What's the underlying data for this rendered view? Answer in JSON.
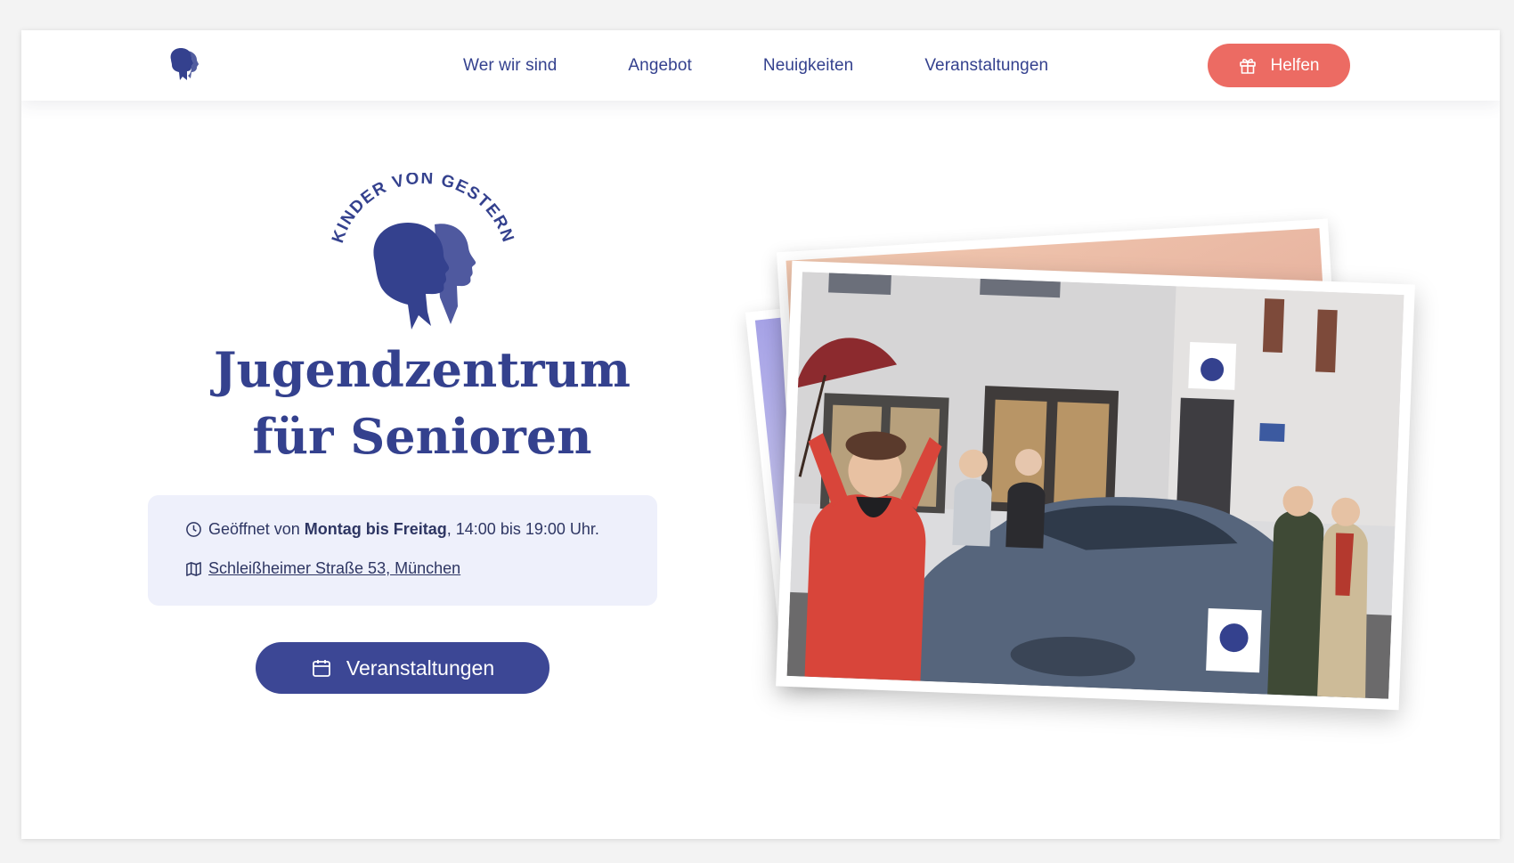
{
  "nav": {
    "links": [
      "Wer wir sind",
      "Angebot",
      "Neuigkeiten",
      "Veranstaltungen"
    ],
    "help_label": "Helfen"
  },
  "hero": {
    "logo_text": "KINDER VON GESTERN",
    "title_line1": "Jugendzentrum",
    "title_line2": "für Senioren",
    "hours_prefix": "Geöffnet von ",
    "hours_days": "Montag bis Freitag",
    "hours_suffix": ", 14:00 bis 19:00 Uhr.",
    "address": "Schleißheimer Straße 53, München",
    "events_button": "Veranstaltungen"
  },
  "colors": {
    "brand_blue": "#34418e",
    "accent_red": "#ec6b63",
    "info_bg": "#eef0fb",
    "button_blue": "#3c4795"
  },
  "icons": {
    "nav_logo": "silhouette-logo-icon",
    "help": "gift-icon",
    "hours": "clock-icon",
    "address": "map-icon",
    "events": "calendar-icon"
  },
  "photo": {
    "description_alt": "Photo in front of the Kinder von Gestern center with a car"
  }
}
